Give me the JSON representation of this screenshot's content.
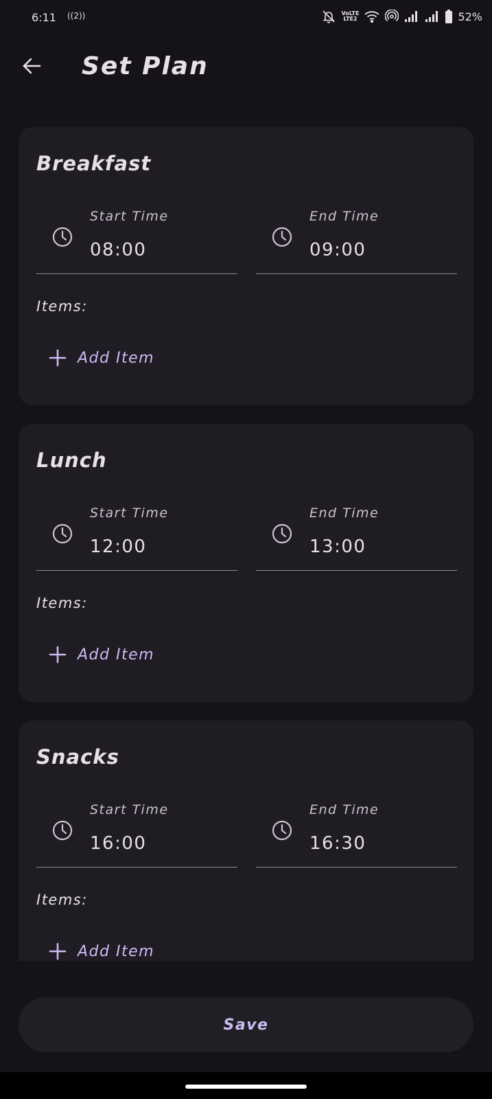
{
  "status_bar": {
    "time": "6:11",
    "hotspot": "((2))",
    "volte_top": "VoLTE",
    "volte_bottom": "LTE2",
    "battery_percent": "52%",
    "icons": [
      "mute-icon",
      "volte-icon",
      "wifi-icon",
      "hotspot-icon",
      "signal-icon",
      "signal-icon",
      "battery-icon"
    ]
  },
  "app_bar": {
    "back_icon": "arrow-left-icon",
    "title": "Set Plan"
  },
  "meals": [
    {
      "title": "Breakfast",
      "start_label": "Start Time",
      "start_value": "08:00",
      "end_label": "End Time",
      "end_value": "09:00",
      "items_label": "Items:",
      "add_item_label": "Add Item"
    },
    {
      "title": "Lunch",
      "start_label": "Start Time",
      "start_value": "12:00",
      "end_label": "End Time",
      "end_value": "13:00",
      "items_label": "Items:",
      "add_item_label": "Add Item"
    },
    {
      "title": "Snacks",
      "start_label": "Start Time",
      "start_value": "16:00",
      "end_label": "End Time",
      "end_value": "16:30",
      "items_label": "Items:",
      "add_item_label": "Add Item"
    }
  ],
  "save_label": "Save",
  "colors": {
    "background": "#151318",
    "card": "#1f1d23",
    "accent": "#cbbcf5",
    "text": "#e6e1e9"
  }
}
